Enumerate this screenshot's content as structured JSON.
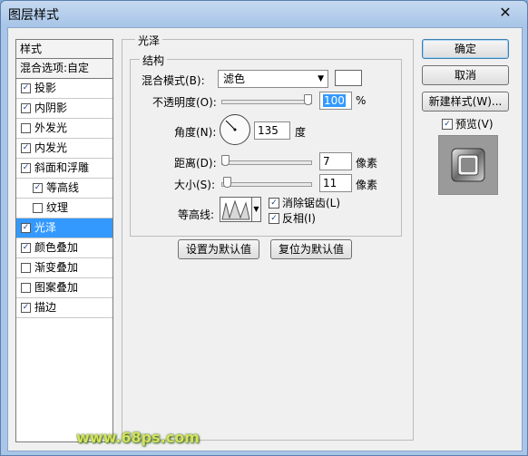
{
  "window": {
    "title": "图层样式",
    "close_glyph": "✕"
  },
  "style_list": {
    "header": "样式",
    "blend_options": "混合选项:自定",
    "items": [
      {
        "label": "投影",
        "checked": true,
        "sub": false,
        "selected": false
      },
      {
        "label": "内阴影",
        "checked": true,
        "sub": false,
        "selected": false
      },
      {
        "label": "外发光",
        "checked": false,
        "sub": false,
        "selected": false
      },
      {
        "label": "内发光",
        "checked": true,
        "sub": false,
        "selected": false
      },
      {
        "label": "斜面和浮雕",
        "checked": true,
        "sub": false,
        "selected": false
      },
      {
        "label": "等高线",
        "checked": true,
        "sub": true,
        "selected": false
      },
      {
        "label": "纹理",
        "checked": false,
        "sub": true,
        "selected": false
      },
      {
        "label": "光泽",
        "checked": true,
        "sub": false,
        "selected": true
      },
      {
        "label": "颜色叠加",
        "checked": true,
        "sub": false,
        "selected": false
      },
      {
        "label": "渐变叠加",
        "checked": false,
        "sub": false,
        "selected": false
      },
      {
        "label": "图案叠加",
        "checked": false,
        "sub": false,
        "selected": false
      },
      {
        "label": "描边",
        "checked": true,
        "sub": false,
        "selected": false
      }
    ]
  },
  "satin": {
    "group_title": "光泽",
    "structure_title": "结构",
    "blend_mode_label": "混合模式(B):",
    "blend_mode_value": "滤色",
    "opacity_label": "不透明度(O):",
    "opacity_value": "100",
    "opacity_unit": "%",
    "opacity_fraction": 1.0,
    "angle_label": "角度(N):",
    "angle_value": "135",
    "angle_unit": "度",
    "distance_label": "距离(D):",
    "distance_value": "7",
    "distance_unit": "像素",
    "distance_fraction": 0.03,
    "size_label": "大小(S):",
    "size_value": "11",
    "size_unit": "像素",
    "size_fraction": 0.05,
    "contour_label": "等高线:",
    "antialias_label": "消除锯齿(L)",
    "antialias_checked": true,
    "invert_label": "反相(I)",
    "invert_checked": true,
    "color_swatch": "#ffffff",
    "set_default_label": "设置为默认值",
    "reset_default_label": "复位为默认值"
  },
  "buttons": {
    "ok": "确定",
    "cancel": "取消",
    "new_style": "新建样式(W)...",
    "preview_label": "预览(V)",
    "preview_checked": true
  },
  "watermark": "www.68ps.com",
  "check_glyph": "✓",
  "colors": {
    "selection": "#3399ff",
    "title_bg": "#a9c6e8"
  }
}
